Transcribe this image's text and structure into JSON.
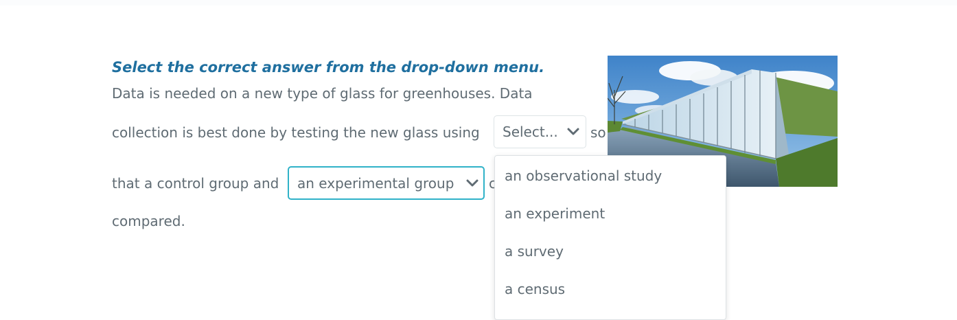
{
  "instruction": "Select the correct answer from the drop-down menu.",
  "question": {
    "line1": "Data is needed on a new type of glass for greenhouses. Data",
    "line2_before": "collection is best done by testing the new glass using",
    "line2_after": "so",
    "line3_before": "that a control group and",
    "line3_after": "c",
    "line4": "compared."
  },
  "dropdown1": {
    "placeholder": "Select...",
    "options": [
      "an observational study",
      "an experiment",
      "a survey",
      "a census"
    ]
  },
  "dropdown2": {
    "value": "an experimental group"
  },
  "image": {
    "icon": "greenhouse-photo"
  },
  "colors": {
    "instruction": "#1f6f9f",
    "text": "#5f6b73",
    "active_border": "#2fb2c8",
    "chevron": "#5f6b73"
  }
}
